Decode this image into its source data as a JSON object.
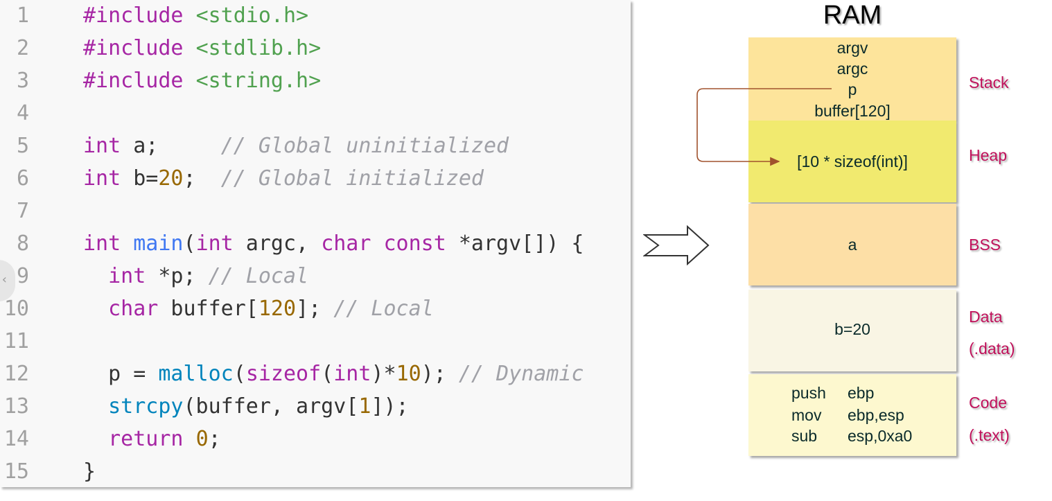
{
  "code": {
    "lines": [
      {
        "n": "1",
        "tokens": [
          {
            "t": "#include ",
            "c": "keyword"
          },
          {
            "t": "<stdio.h>",
            "c": "string"
          }
        ]
      },
      {
        "n": "2",
        "tokens": [
          {
            "t": "#include ",
            "c": "keyword"
          },
          {
            "t": "<stdlib.h>",
            "c": "string"
          }
        ]
      },
      {
        "n": "3",
        "tokens": [
          {
            "t": "#include ",
            "c": "keyword"
          },
          {
            "t": "<string.h>",
            "c": "string"
          }
        ]
      },
      {
        "n": "4",
        "tokens": []
      },
      {
        "n": "5",
        "tokens": [
          {
            "t": "int",
            "c": "keyword"
          },
          {
            "t": " a;     ",
            "c": "default"
          },
          {
            "t": "// Global uninitialized",
            "c": "comment"
          }
        ]
      },
      {
        "n": "6",
        "tokens": [
          {
            "t": "int",
            "c": "keyword"
          },
          {
            "t": " b=",
            "c": "default"
          },
          {
            "t": "20",
            "c": "number"
          },
          {
            "t": ";  ",
            "c": "default"
          },
          {
            "t": "// Global initialized",
            "c": "comment"
          }
        ]
      },
      {
        "n": "7",
        "tokens": []
      },
      {
        "n": "8",
        "tokens": [
          {
            "t": "int",
            "c": "keyword"
          },
          {
            "t": " ",
            "c": "default"
          },
          {
            "t": "main",
            "c": "function"
          },
          {
            "t": "(",
            "c": "default"
          },
          {
            "t": "int",
            "c": "keyword"
          },
          {
            "t": " argc, ",
            "c": "default"
          },
          {
            "t": "char",
            "c": "keyword"
          },
          {
            "t": " ",
            "c": "default"
          },
          {
            "t": "const",
            "c": "keyword"
          },
          {
            "t": " *argv[]) {",
            "c": "default"
          }
        ]
      },
      {
        "n": "9",
        "tokens": [
          {
            "t": "  ",
            "c": "default"
          },
          {
            "t": "int",
            "c": "keyword"
          },
          {
            "t": " *p; ",
            "c": "default"
          },
          {
            "t": "// Local",
            "c": "comment"
          }
        ]
      },
      {
        "n": "10",
        "tokens": [
          {
            "t": "  ",
            "c": "default"
          },
          {
            "t": "char",
            "c": "keyword"
          },
          {
            "t": " buffer[",
            "c": "default"
          },
          {
            "t": "120",
            "c": "number"
          },
          {
            "t": "]; ",
            "c": "default"
          },
          {
            "t": "// Local",
            "c": "comment"
          }
        ]
      },
      {
        "n": "11",
        "tokens": []
      },
      {
        "n": "12",
        "tokens": [
          {
            "t": "  p = ",
            "c": "default"
          },
          {
            "t": "malloc",
            "c": "builtin"
          },
          {
            "t": "(",
            "c": "default"
          },
          {
            "t": "sizeof",
            "c": "keyword"
          },
          {
            "t": "(",
            "c": "default"
          },
          {
            "t": "int",
            "c": "keyword"
          },
          {
            "t": ")*",
            "c": "default"
          },
          {
            "t": "10",
            "c": "number"
          },
          {
            "t": "); ",
            "c": "default"
          },
          {
            "t": "// Dynamic",
            "c": "comment"
          }
        ]
      },
      {
        "n": "13",
        "tokens": [
          {
            "t": "  ",
            "c": "default"
          },
          {
            "t": "strcpy",
            "c": "builtin"
          },
          {
            "t": "(buffer, argv[",
            "c": "default"
          },
          {
            "t": "1",
            "c": "number"
          },
          {
            "t": "]);",
            "c": "default"
          }
        ]
      },
      {
        "n": "14",
        "tokens": [
          {
            "t": "  ",
            "c": "default"
          },
          {
            "t": "return",
            "c": "keyword"
          },
          {
            "t": " ",
            "c": "default"
          },
          {
            "t": "0",
            "c": "number"
          },
          {
            "t": ";",
            "c": "default"
          }
        ]
      },
      {
        "n": "15",
        "tokens": [
          {
            "t": "}",
            "c": "default"
          }
        ]
      }
    ]
  },
  "ram": {
    "title": "RAM",
    "stack": {
      "items": [
        "argv",
        "argc",
        "p",
        "buffer[120]"
      ],
      "label": "Stack",
      "color": "#fde49b"
    },
    "heap": {
      "item": "[10 * sizeof(int)]",
      "label": "Heap",
      "color": "#f1ea6f"
    },
    "bss": {
      "item": "a",
      "label": "BSS",
      "color": "#fddfa6"
    },
    "data": {
      "item": "b=20",
      "label": "Data",
      "sublabel": "(.data)",
      "color": "#f9f5e4"
    },
    "code": {
      "asm": [
        {
          "op": "push",
          "arg": "ebp"
        },
        {
          "op": "mov",
          "arg": "ebp,esp"
        },
        {
          "op": "sub",
          "arg": "esp,0xa0"
        }
      ],
      "label": "Code",
      "sublabel": "(.text)",
      "color": "#fdf8cf"
    }
  },
  "colors": {
    "label": "#c0105a",
    "pointer_arrow": "#a0522d"
  }
}
